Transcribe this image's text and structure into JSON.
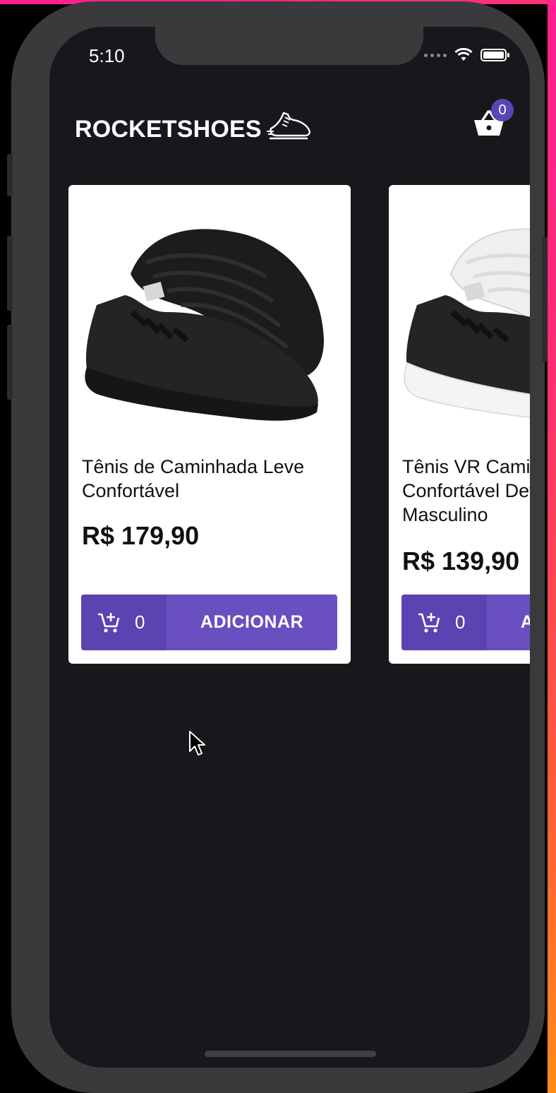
{
  "status_bar": {
    "time": "5:10"
  },
  "header": {
    "title": "ROCKETSHOES",
    "cart_count": "0"
  },
  "colors": {
    "background": "#18181c",
    "accent": "#6a4fc0",
    "accent_dark": "#5b43b2",
    "badge": "#5a45b6"
  },
  "products": [
    {
      "title": "Tênis de Caminhada Leve Confortável",
      "price": "R$ 179,90",
      "quantity": "0",
      "button_label": "ADICIONAR",
      "image": "black-sneaker"
    },
    {
      "title": "Tênis VR Caminhada Confortável Detalhes Couro Masculino",
      "price": "R$ 139,90",
      "quantity": "0",
      "button_label": "ADICIONAR",
      "image": "black-white-sneaker"
    }
  ]
}
